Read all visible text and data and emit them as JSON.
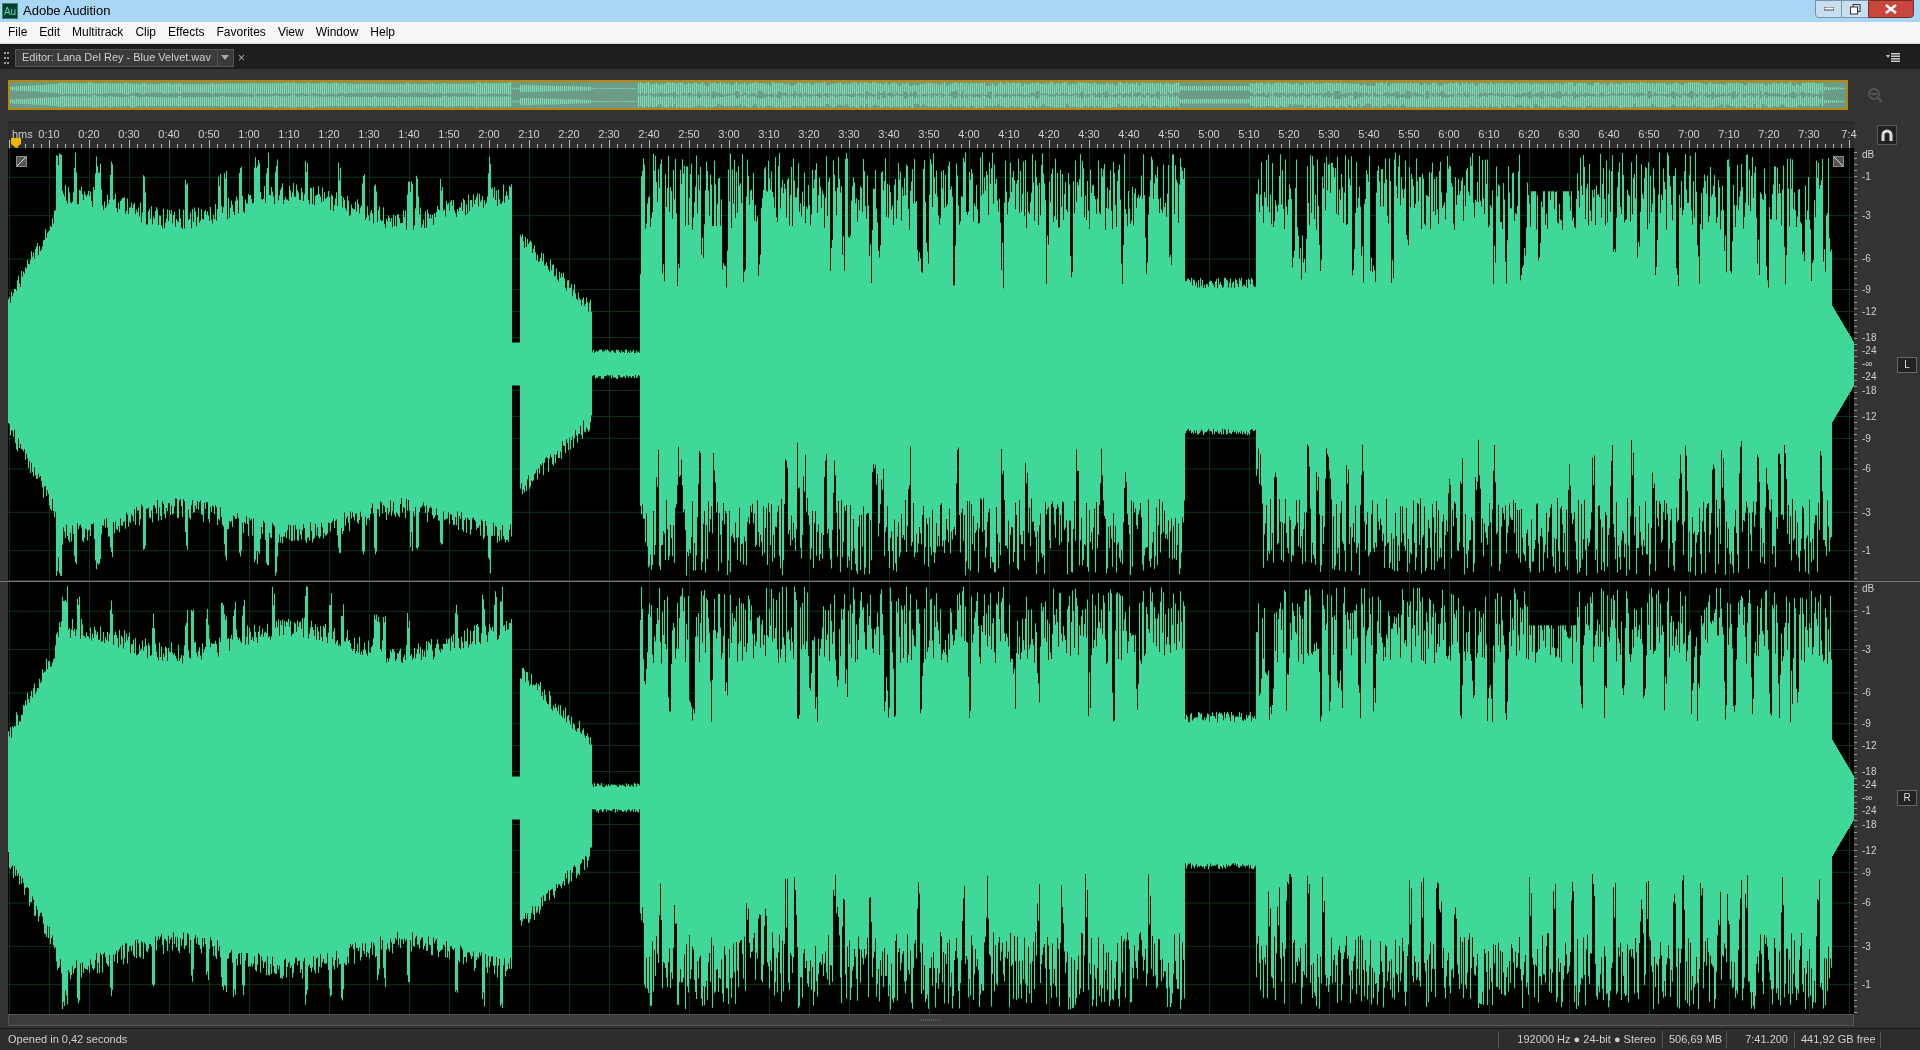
{
  "window": {
    "title": "Adobe Audition",
    "app_icon": "Au"
  },
  "menu": [
    "File",
    "Edit",
    "Multitrack",
    "Clip",
    "Effects",
    "Favorites",
    "View",
    "Window",
    "Help"
  ],
  "editor_tab": {
    "label": "Editor: Lana Del Rey - Blue Velvet.wav",
    "close": "×"
  },
  "ruler": {
    "unit": "hms",
    "labels": [
      "0:10",
      "0:20",
      "0:30",
      "0:40",
      "0:50",
      "1:00",
      "1:10",
      "1:20",
      "1:30",
      "1:40",
      "1:50",
      "2:00",
      "2:10",
      "2:20",
      "2:30",
      "2:40",
      "2:50",
      "3:00",
      "3:10",
      "3:20",
      "3:30",
      "3:40",
      "3:50",
      "4:00",
      "4:10",
      "4:20",
      "4:30",
      "4:40",
      "4:50",
      "5:00",
      "5:10",
      "5:20",
      "5:30",
      "5:40",
      "5:50",
      "6:00",
      "6:10",
      "6:20",
      "6:30",
      "6:40",
      "6:50",
      "7:00",
      "7:10",
      "7:20",
      "7:30",
      "7:4"
    ]
  },
  "channels": [
    {
      "label": "L",
      "db_scale": [
        "dB",
        "-1",
        "-3",
        "-6",
        "-9",
        "-12",
        "-18",
        "-24",
        "-∞",
        "-24",
        "-18",
        "-12",
        "-9",
        "-6",
        "-3",
        "-1"
      ]
    },
    {
      "label": "R",
      "db_scale": [
        "dB",
        "-1",
        "-3",
        "-6",
        "-9",
        "-12",
        "-18",
        "-24",
        "-∞",
        "-24",
        "-18",
        "-12",
        "-9",
        "-6",
        "-3",
        "-1"
      ]
    }
  ],
  "status_bar": {
    "message": "Opened in 0,42 seconds",
    "format": "192000 Hz ● 24-bit ● Stereo",
    "size": "506,69 MB",
    "duration": "7:41.200",
    "free_space": "441,92 GB free"
  }
}
